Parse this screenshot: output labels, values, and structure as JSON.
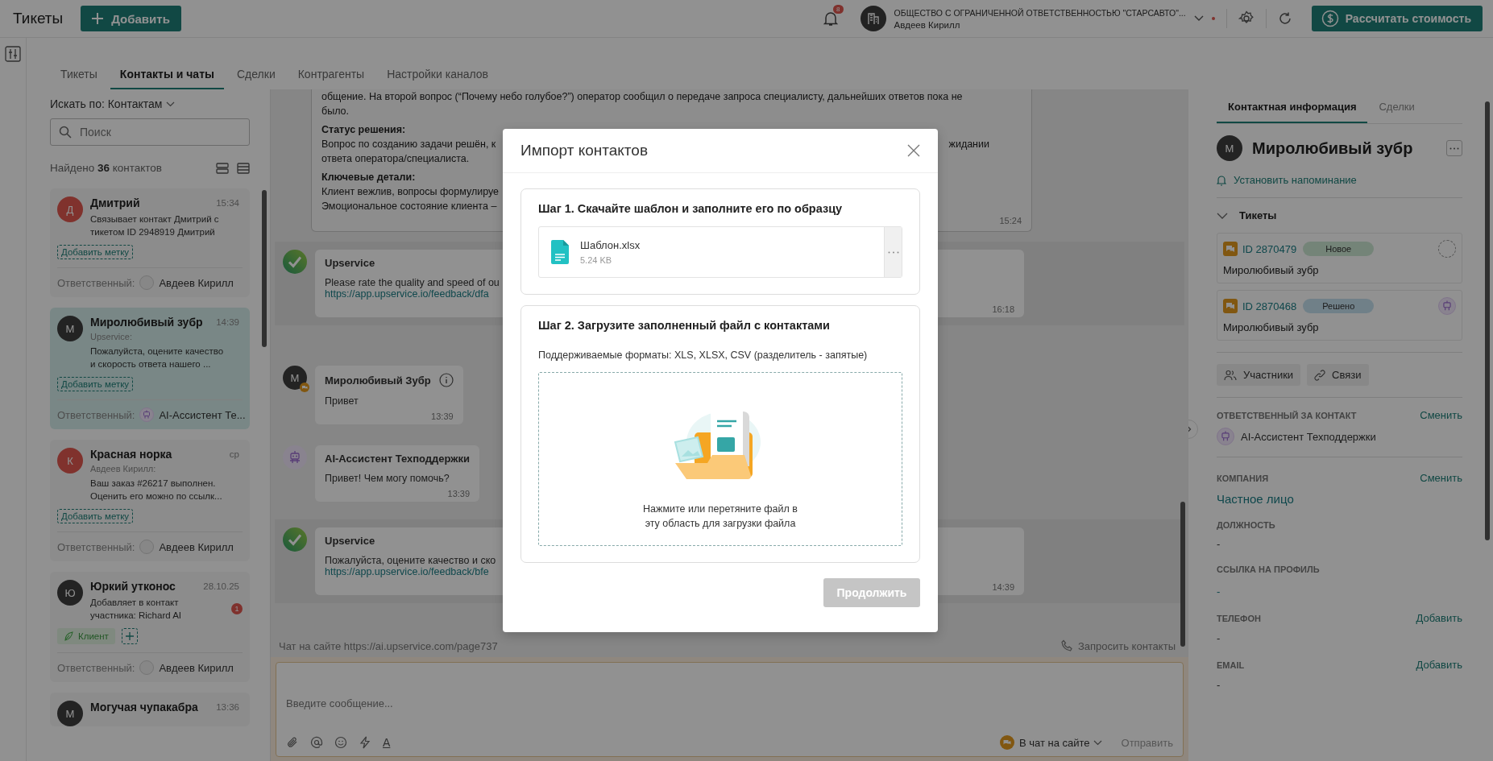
{
  "header": {
    "title": "Тикеты",
    "add_button": "Добавить",
    "notification_count": "8",
    "org_name": "ОБЩЕСТВО С ОГРАНИЧЕННОЙ ОТВЕТСТВЕННОСТЬЮ \"СТАРСАВТО\"...",
    "user_name": "Авдеев Кирилл",
    "calc_button": "Рассчитать стоимость"
  },
  "tabs": [
    {
      "label": "Тикеты",
      "selected": false
    },
    {
      "label": "Контакты и чаты",
      "selected": true
    },
    {
      "label": "Сделки",
      "selected": false
    },
    {
      "label": "Контрагенты",
      "selected": false
    },
    {
      "label": "Настройки каналов",
      "selected": false
    }
  ],
  "contacts": {
    "search_by": "Искать по: Контактам",
    "search_placeholder": "Поиск",
    "found": "Найдено **36** контактов",
    "items": [
      {
        "initial": "Д",
        "color": "#80322d",
        "name": "Дмитрий",
        "time": "15:34",
        "preview": "Связывает контакт Дмитрий с\nтикетом ID 2948919 Дмитрий",
        "add_tag": "Добавить метку",
        "responsible_label": "Ответственный:",
        "responsible": "Авдеев Кирилл",
        "responsible_avatar": {
          "kind": "person"
        },
        "selected": false
      },
      {
        "initial": "М",
        "color": "#242424",
        "name": "Миролюбивый зубр",
        "time": "14:39",
        "sender": "Upservice:",
        "preview": "Пожалуйста, оцените качество\nи скорость ответа нашего ...",
        "add_tag": "Добавить метку",
        "responsible_label": "Ответственный:",
        "responsible": "AI-Ассистент Те...",
        "responsible_avatar": {
          "kind": "bot"
        },
        "selected": true
      },
      {
        "initial": "К",
        "color": "#80322d",
        "name": "Красная норка",
        "time": "ср",
        "sender": "Авдеев Кирилл:",
        "preview": "Ваш заказ #26217 выполнен.\nОценить его можно по ссылк...",
        "add_tag": "Добавить метку",
        "responsible_label": "Ответственный:",
        "responsible": "Авдеев Кирилл",
        "responsible_avatar": {
          "kind": "person"
        },
        "selected": false
      },
      {
        "initial": "Ю",
        "color": "#242424",
        "name": "Юркий утконос",
        "time": "28.10.25",
        "preview": "Добавляет в контакт\nучастника: Richard AI",
        "unread": "1",
        "tag": "Клиент",
        "responsible_label": "Ответственный:",
        "responsible": "Авдеев Кирилл",
        "responsible_avatar": {
          "kind": "person"
        },
        "selected": false
      },
      {
        "initial": "М",
        "color": "#242424",
        "name": "Могучая чупакабра",
        "time": "13:36",
        "selected": false
      }
    ]
  },
  "chat": {
    "summary": {
      "time": "15:24",
      "parts": [
        {
          "kind": "text",
          "text": "общение. На второй вопрос (“Почему небо голубое?”) оператор сообщил о передаче запроса специалисту, дальнейших ответов пока не\nбыло."
        },
        {
          "kind": "heading",
          "text": "Статус решения:"
        },
        {
          "kind": "split",
          "left": "Вопрос по созданию задачи решён, к",
          "right": "жидании"
        },
        {
          "kind": "text",
          "text": "ответа оператора/специалиста."
        },
        {
          "kind": "heading",
          "text": "Ключевые детали:"
        },
        {
          "kind": "text",
          "text": "Клиент вежлив, вопросы формулируе"
        },
        {
          "kind": "text",
          "text": "Эмоциональное состояние клиента –"
        }
      ]
    },
    "messages": [
      {
        "kind": "service",
        "author": "Upservice",
        "text": "Please rate the quality and speed of ou",
        "link": "https://app.upservice.io/feedback/dfa",
        "time": "16:18"
      },
      {
        "kind": "client",
        "initial": "М",
        "author": "Миролюбивый Зубр",
        "text": "Привет",
        "time": "13:39"
      },
      {
        "kind": "bot",
        "author": "AI-Ассистент Техподдержки",
        "text": "Привет! Чем могу помочь?",
        "time": "13:39"
      },
      {
        "kind": "service",
        "author": "Upservice",
        "text": "Пожалуйста, оцените качество и ско",
        "link": "https://app.upservice.io/feedback/bfe",
        "time": "14:39"
      }
    ],
    "site": "Чат на сайте https://ai.upservice.com/page737",
    "request_contacts": "Запросить контакты",
    "composer": {
      "placeholder": "Введите сообщение...",
      "format_icon": "A",
      "channel": "В чат на сайте",
      "send_button": "Отправить"
    }
  },
  "details": {
    "tabs": [
      {
        "label": "Контактная информация",
        "selected": true
      },
      {
        "label": "Сделки",
        "selected": false
      }
    ],
    "initial": "М",
    "name": "Миролюбивый зубр",
    "reminder": "Установить напоминание",
    "tickets_title": "Тикеты",
    "tickets_expanded": true,
    "tickets": [
      {
        "id": "ID 2870479",
        "status": "Новое",
        "color": "#758479",
        "assignee": {
          "kind": "none"
        },
        "name": "Миролюбивый зубр"
      },
      {
        "id": "ID 2870468",
        "status": "Решено",
        "color": "#718088",
        "assignee": {
          "kind": "bot"
        },
        "name": "Миролюбивый зубр"
      }
    ],
    "participants_button": "Участники",
    "links_button": "Связи",
    "fields": [
      {
        "label": "ОТВЕТСТВЕННЫЙ ЗА КОНТАКТ",
        "action": "Сменить",
        "kind": "person",
        "value": "AI-Ассистент Техподдержки"
      },
      {
        "label": "КОМПАНИЯ",
        "action": "Сменить",
        "kind": "link",
        "value": "Частное лицо"
      },
      {
        "label": "ДОЛЖНОСТЬ",
        "kind": "text",
        "value": "-"
      },
      {
        "label": "ССЫЛКА НА ПРОФИЛЬ",
        "kind": "dash-link",
        "value": "-"
      },
      {
        "label": "ТЕЛЕФОН",
        "action": "Добавить",
        "kind": "text",
        "value": "-"
      },
      {
        "label": "EMAIL",
        "action": "Добавить",
        "kind": "text",
        "value": "-"
      }
    ]
  },
  "modal": {
    "title": "Импорт контактов",
    "step1_title": "Шаг 1. Скачайте шаблон и заполните его по образцу",
    "file_name": "Шаблон.xlsx",
    "file_size": "5.24 KB",
    "step2_title": "Шаг 2. Загрузите заполненный файл с контактами",
    "formats": "Поддерживаемые форматы: XLS, XLSX, CSV (разделитель - запятые)",
    "drop_text": "Нажмите или перетяните файл в\nэту область для загрузки файла",
    "continue_button": "Продолжить",
    "continue_disabled": true
  }
}
